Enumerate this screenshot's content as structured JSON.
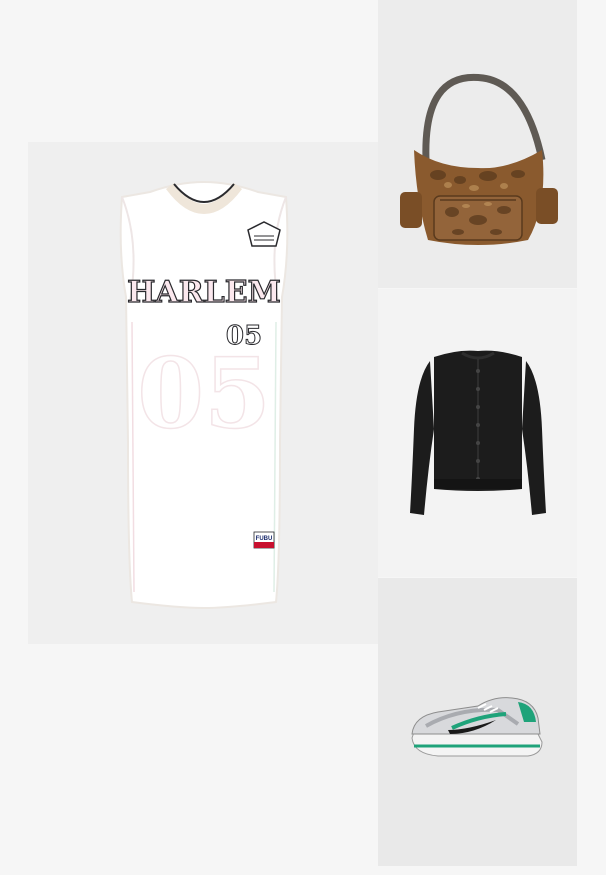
{
  "outfit": {
    "items": [
      {
        "label": "White basketball jersey dress",
        "print": {
          "team": "HARLEM",
          "number": "05",
          "back_number": "05",
          "badge": "FUBU"
        },
        "colors": {
          "tile": "#efefef",
          "garment": "#ffffff",
          "trim": "#e6ded6",
          "print": "#2a2a2e"
        }
      },
      {
        "label": "Snake print shoulder bag",
        "colors": {
          "tile": "#ececec",
          "leather": "#8a5a2e",
          "pattern": "#5a3a1d",
          "strap": "#5f5a54"
        }
      },
      {
        "label": "Black knit cardigan",
        "colors": {
          "tile": "#f3f3f3",
          "knit": "#1c1c1c"
        }
      },
      {
        "label": "Silver and green running sneaker",
        "colors": {
          "tile": "#e9e9e9",
          "upper": "#d8d9dc",
          "accent": "#1fa37a"
        }
      }
    ]
  }
}
